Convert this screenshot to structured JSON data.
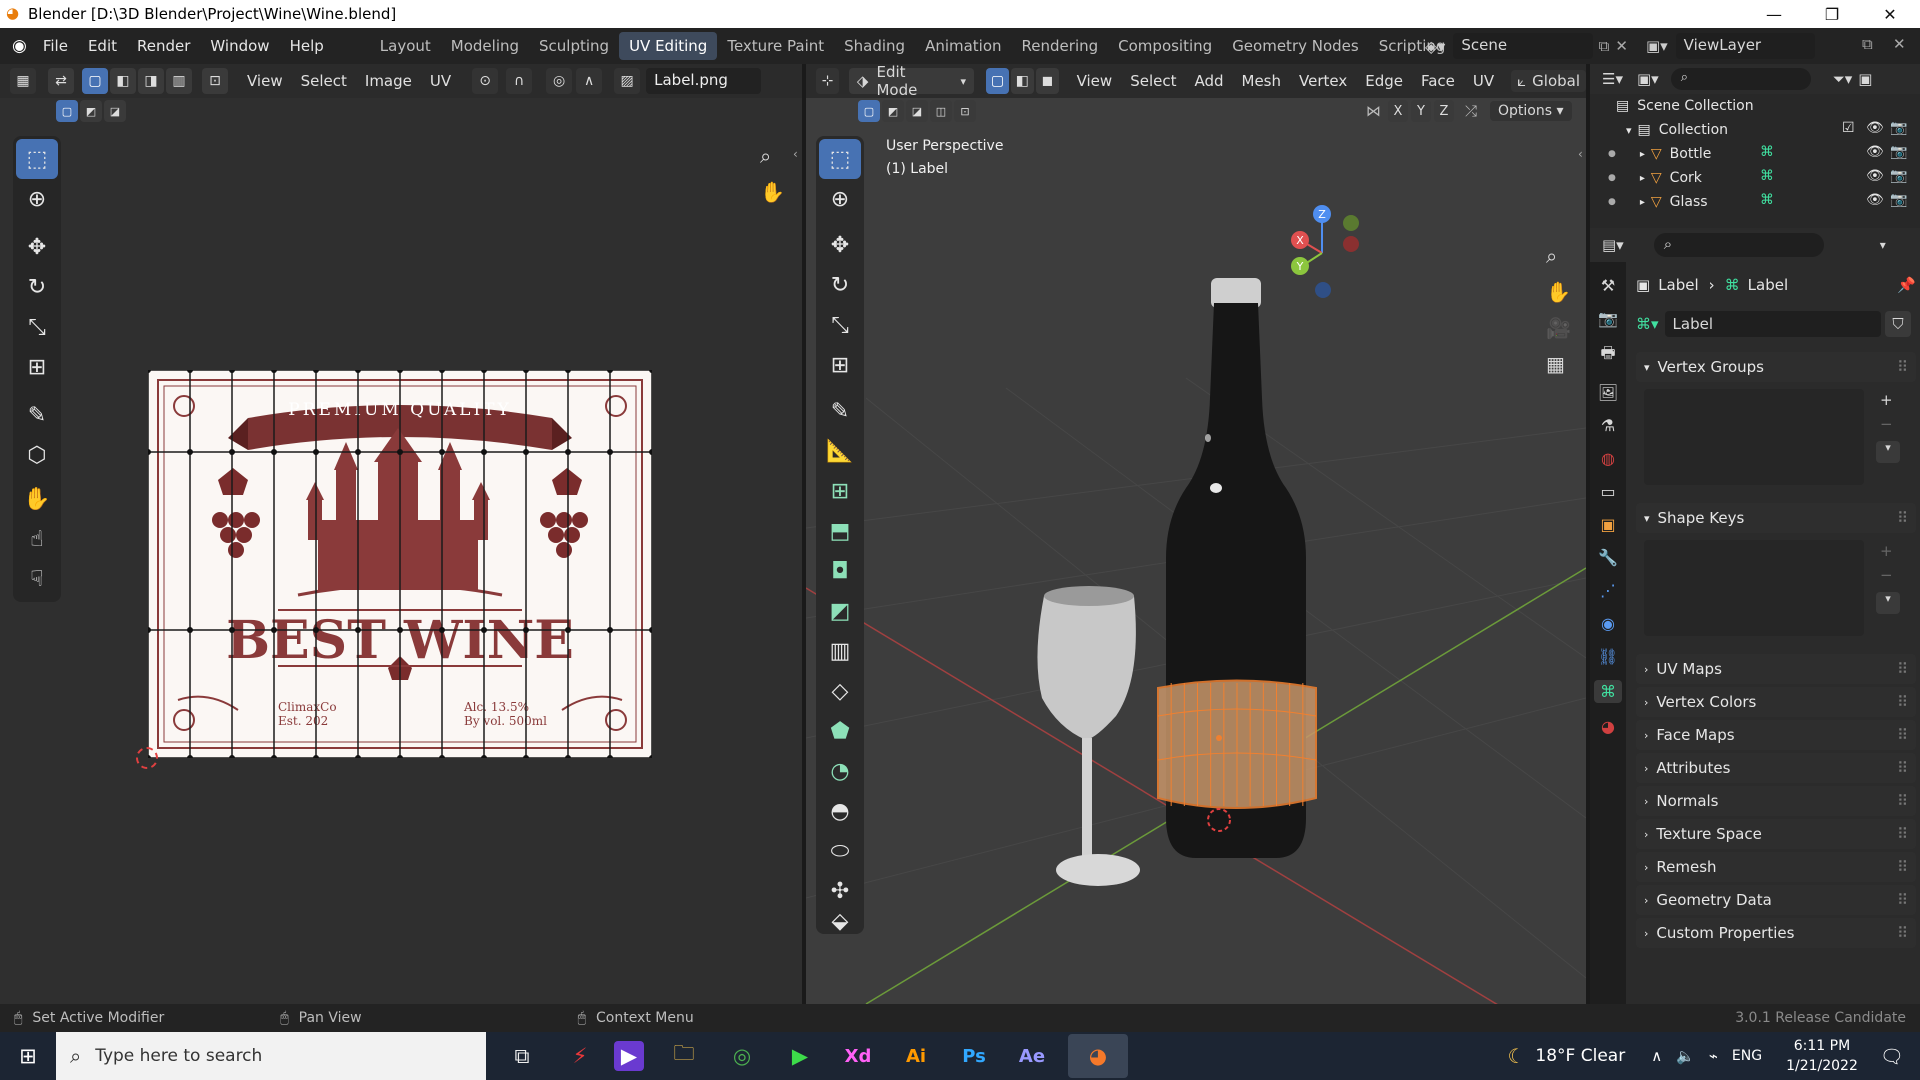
{
  "window": {
    "title": "Blender [D:\\3D Blender\\Project\\Wine\\Wine.blend]"
  },
  "menu": [
    "File",
    "Edit",
    "Render",
    "Window",
    "Help"
  ],
  "workspaces": [
    "Layout",
    "Modeling",
    "Sculpting",
    "UV Editing",
    "Texture Paint",
    "Shading",
    "Animation",
    "Rendering",
    "Compositing",
    "Geometry Nodes",
    "Scripting"
  ],
  "active_workspace": "UV Editing",
  "scene": {
    "name": "Scene",
    "view_layer": "ViewLayer"
  },
  "uv_editor": {
    "menus": [
      "View",
      "Select",
      "Image",
      "UV"
    ],
    "image_name": "Label.png",
    "label_texture": {
      "banner": "PREMIUM QUALITY",
      "headline": "BEST WINE",
      "left_small_1": "ClimaxCo",
      "left_small_2": "Est. 202",
      "right_small_1": "Alc. 13.5%",
      "right_small_2": "By vol. 500ml"
    }
  },
  "viewport": {
    "mode": "Edit Mode",
    "menus": [
      "View",
      "Select",
      "Add",
      "Mesh",
      "Vertex",
      "Edge",
      "Face",
      "UV"
    ],
    "transform": "Global",
    "options": "Options",
    "overlay_line1": "User Perspective",
    "overlay_line2": "(1) Label",
    "axes": [
      "X",
      "Y",
      "Z"
    ]
  },
  "outliner": {
    "root": "Scene Collection",
    "collection": "Collection",
    "items": [
      "Bottle",
      "Cork",
      "Glass"
    ]
  },
  "properties": {
    "breadcrumb_obj": "Label",
    "breadcrumb_data": "Label",
    "mesh_name": "Label",
    "panels_open": [
      "Vertex Groups",
      "Shape Keys"
    ],
    "panels_closed": [
      "UV Maps",
      "Vertex Colors",
      "Face Maps",
      "Attributes",
      "Normals",
      "Texture Space",
      "Remesh",
      "Geometry Data",
      "Custom Properties"
    ]
  },
  "statusbar": {
    "left": "Set Active Modifier",
    "middle": "Pan View",
    "right": "Context Menu",
    "version": "3.0.1 Release Candidate"
  },
  "taskbar": {
    "search_placeholder": "Type here to search",
    "weather": "18°F  Clear",
    "lang": "ENG",
    "time": "6:11 PM",
    "date": "1/21/2022",
    "apps": [
      "Xd",
      "Ai",
      "Ps",
      "Ae"
    ]
  }
}
